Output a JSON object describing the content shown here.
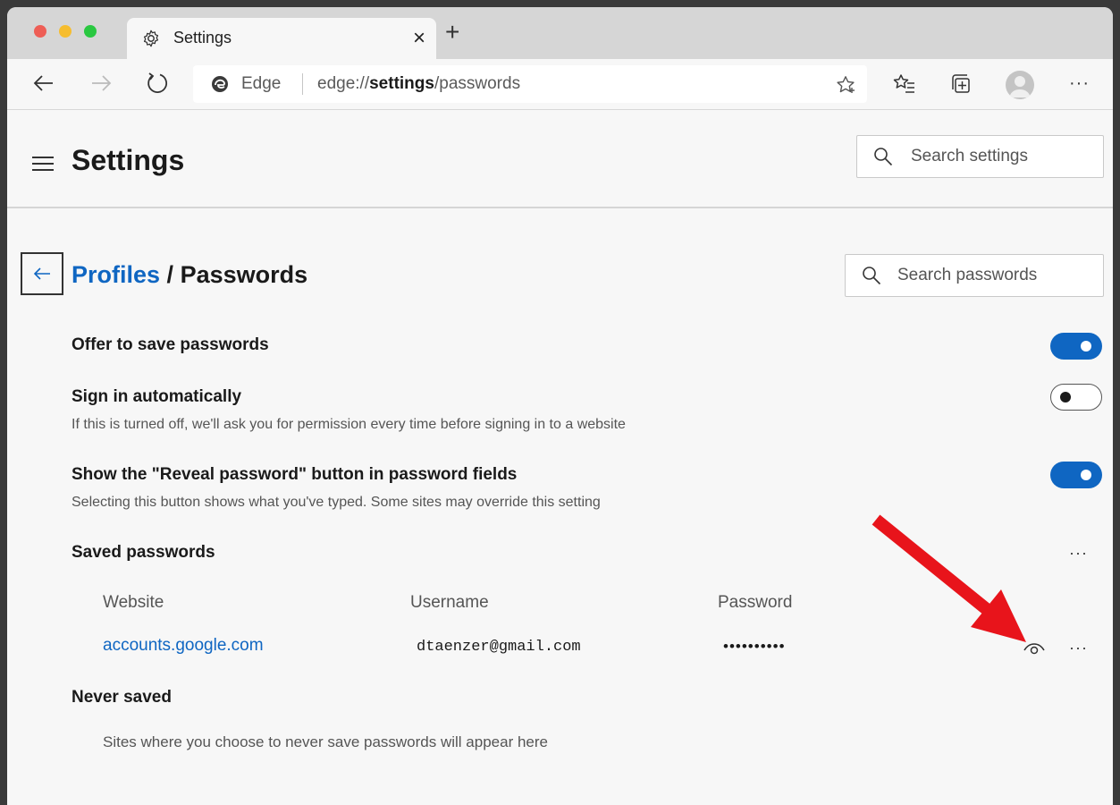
{
  "tab": {
    "title": "Settings",
    "close_glyph": "×",
    "new_tab_glyph": "+"
  },
  "address": {
    "brand": "Edge",
    "url_prefix": "edge://",
    "url_bold": "settings",
    "url_suffix": "/passwords"
  },
  "toolbar": {
    "more_glyph": "···"
  },
  "header": {
    "title": "Settings",
    "search_placeholder": "Search settings"
  },
  "breadcrumb": {
    "parent": "Profiles",
    "separator": " / ",
    "current": "Passwords"
  },
  "password_search": {
    "placeholder": "Search passwords"
  },
  "settings": [
    {
      "title": "Offer to save passwords",
      "subtitle": "",
      "enabled": true
    },
    {
      "title": "Sign in automatically",
      "subtitle": "If this is turned off, we'll ask you for permission every time before signing in to a website",
      "enabled": false
    },
    {
      "title": "Show the \"Reveal password\" button in password fields",
      "subtitle": "Selecting this button shows what you've typed. Some sites may override this setting",
      "enabled": true
    }
  ],
  "saved": {
    "title": "Saved passwords",
    "more_glyph": "···",
    "columns": [
      "Website",
      "Username",
      "Password"
    ],
    "rows": [
      {
        "website": "accounts.google.com",
        "username": "dtaenzer@gmail.com",
        "password": "••••••••••",
        "more_glyph": "···"
      }
    ]
  },
  "never_saved": {
    "title": "Never saved",
    "empty_text": "Sites where you choose to never save passwords will appear here"
  },
  "icons": {
    "reveal": "eye-icon",
    "annotation": "red-arrow-annotation"
  },
  "colors": {
    "accent": "#0f66c2",
    "annotation": "#e8141b"
  }
}
